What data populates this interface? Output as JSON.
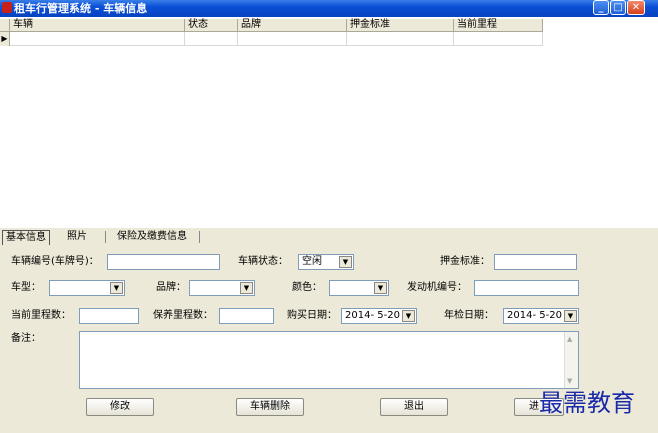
{
  "window": {
    "title": "租车行管理系统 - 车辆信息",
    "buttons": [
      "minimize",
      "maximize",
      "close"
    ],
    "colors": {
      "titlebar": "#0a4fd6",
      "panel": "#ece9d8"
    }
  },
  "grid": {
    "columns": [
      "车辆",
      "状态",
      "品牌",
      "押金标准",
      "当前里程"
    ],
    "rows": [
      [
        "",
        "",
        "",
        "",
        ""
      ]
    ],
    "selector_glyph": "▶"
  },
  "tabs": [
    {
      "label": "基本信息",
      "active": true
    },
    {
      "label": "照片",
      "active": false
    },
    {
      "label": "保险及缴费信息",
      "active": false
    }
  ],
  "form": {
    "vehicle_no_label": "车辆编号(车牌号)：",
    "vehicle_no_value": "",
    "status_label": "车辆状态：",
    "status_value": "空闲",
    "deposit_label": "押金标准：",
    "deposit_value": "",
    "model_label": "车型：",
    "model_value": "",
    "brand_label": "品牌：",
    "brand_value": "",
    "color_label": "颜色：",
    "color_value": "",
    "engine_label": "发动机编号：",
    "engine_value": "",
    "mileage_label": "当前里程数：",
    "mileage_value": "",
    "maint_label": "保养里程数：",
    "maint_value": "",
    "buy_date_label": "购买日期：",
    "buy_date_value": "2014- 5-20",
    "inspect_label": "年检日期：",
    "inspect_value": "2014- 5-20",
    "remark_label": "备注：",
    "remark_value": ""
  },
  "buttons": {
    "modify": "修改",
    "delete": "车辆删除",
    "exit": "退出",
    "fourth": "进"
  },
  "watermark": "最需教育",
  "icons": {
    "dropdown": "▼",
    "scroll_up": "▲",
    "scroll_down": "▼"
  }
}
